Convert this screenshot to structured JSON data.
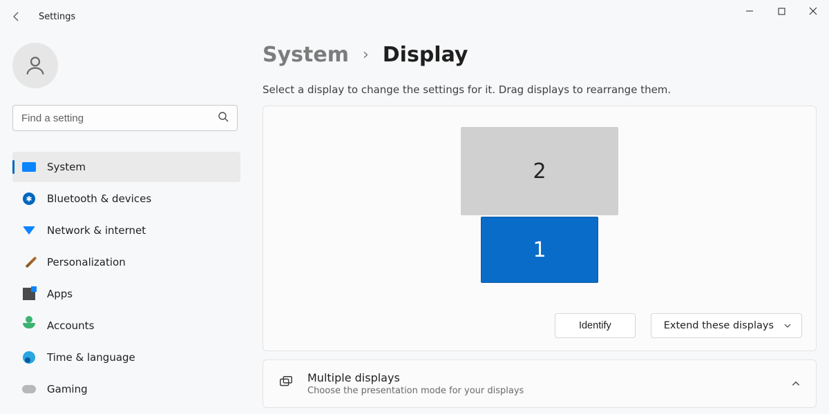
{
  "window": {
    "title": "Settings"
  },
  "search": {
    "placeholder": "Find a setting"
  },
  "sidebar": {
    "items": [
      {
        "label": "System"
      },
      {
        "label": "Bluetooth & devices"
      },
      {
        "label": "Network & internet"
      },
      {
        "label": "Personalization"
      },
      {
        "label": "Apps"
      },
      {
        "label": "Accounts"
      },
      {
        "label": "Time & language"
      },
      {
        "label": "Gaming"
      }
    ]
  },
  "breadcrumb": {
    "parent": "System",
    "separator": "›",
    "current": "Display"
  },
  "display": {
    "subtitle": "Select a display to change the settings for it. Drag displays to rearrange them.",
    "monitors": {
      "primary": "1",
      "secondary": "2"
    },
    "identify_label": "Identify",
    "mode_label": "Extend these displays"
  },
  "multiple_displays": {
    "title": "Multiple displays",
    "subtitle": "Choose the presentation mode for your displays"
  }
}
